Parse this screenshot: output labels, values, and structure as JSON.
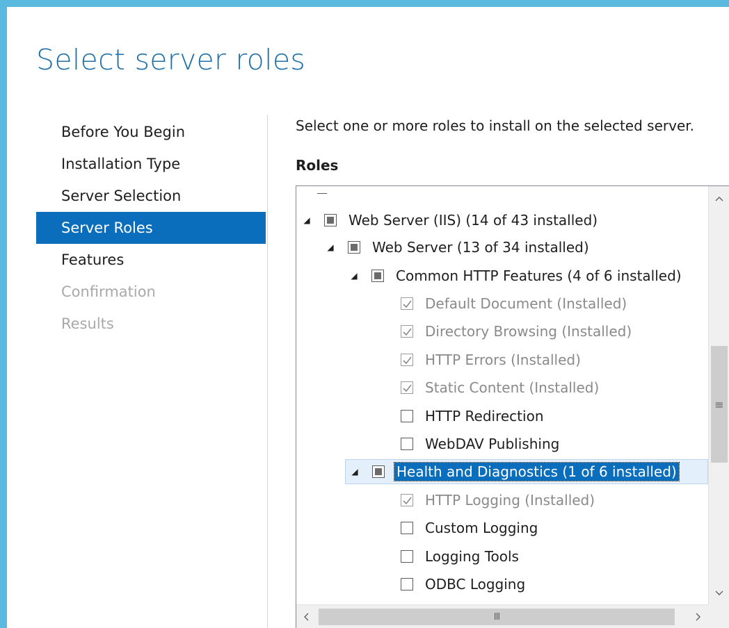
{
  "page": {
    "title": "Select server roles"
  },
  "nav": {
    "items": [
      {
        "label": "Before You Begin",
        "state": "normal"
      },
      {
        "label": "Installation Type",
        "state": "normal"
      },
      {
        "label": "Server Selection",
        "state": "normal"
      },
      {
        "label": "Server Roles",
        "state": "active"
      },
      {
        "label": "Features",
        "state": "normal"
      },
      {
        "label": "Confirmation",
        "state": "disabled"
      },
      {
        "label": "Results",
        "state": "disabled"
      }
    ]
  },
  "main": {
    "instruction": "Select one or more roles to install on the selected server.",
    "roles_heading": "Roles"
  },
  "tree": {
    "rows": [
      {
        "label": "Web Server (IIS) (14 of 43 installed)",
        "checkbox": "partial",
        "expander": "expanded"
      },
      {
        "label": "Web Server (13 of 34 installed)",
        "checkbox": "partial",
        "expander": "expanded"
      },
      {
        "label": "Common HTTP Features (4 of 6 installed)",
        "checkbox": "partial",
        "expander": "expanded"
      },
      {
        "label": "Default Document (Installed)",
        "checkbox": "checked-installed"
      },
      {
        "label": "Directory Browsing (Installed)",
        "checkbox": "checked-installed"
      },
      {
        "label": "HTTP Errors (Installed)",
        "checkbox": "checked-installed"
      },
      {
        "label": "Static Content (Installed)",
        "checkbox": "checked-installed"
      },
      {
        "label": "HTTP Redirection",
        "checkbox": "unchecked"
      },
      {
        "label": "WebDAV Publishing",
        "checkbox": "unchecked"
      },
      {
        "label": "Health and Diagnostics (1 of 6 installed)",
        "checkbox": "partial",
        "expander": "expanded",
        "selected": true
      },
      {
        "label": "HTTP Logging (Installed)",
        "checkbox": "checked-installed"
      },
      {
        "label": "Custom Logging",
        "checkbox": "unchecked"
      },
      {
        "label": "Logging Tools",
        "checkbox": "unchecked"
      },
      {
        "label": "ODBC Logging",
        "checkbox": "unchecked"
      }
    ]
  },
  "scrollbars": {
    "vertical_thumb_glyph": "≡",
    "horizontal_thumb_glyph": "III"
  },
  "icons": {
    "expander": "expanded-triangle-icon",
    "check": "checkmark-icon",
    "partial": "partial-square-icon",
    "scroll_up": "chevron-up-icon",
    "scroll_down": "chevron-down-icon",
    "scroll_left": "chevron-left-icon",
    "scroll_right": "chevron-right-icon"
  },
  "colors": {
    "accent": "#0a6ebd",
    "title": "#1e6fa9",
    "frame": "#5ab9de",
    "disabled_text": "#a9a9a9",
    "installed_text": "#8a8a8a"
  }
}
